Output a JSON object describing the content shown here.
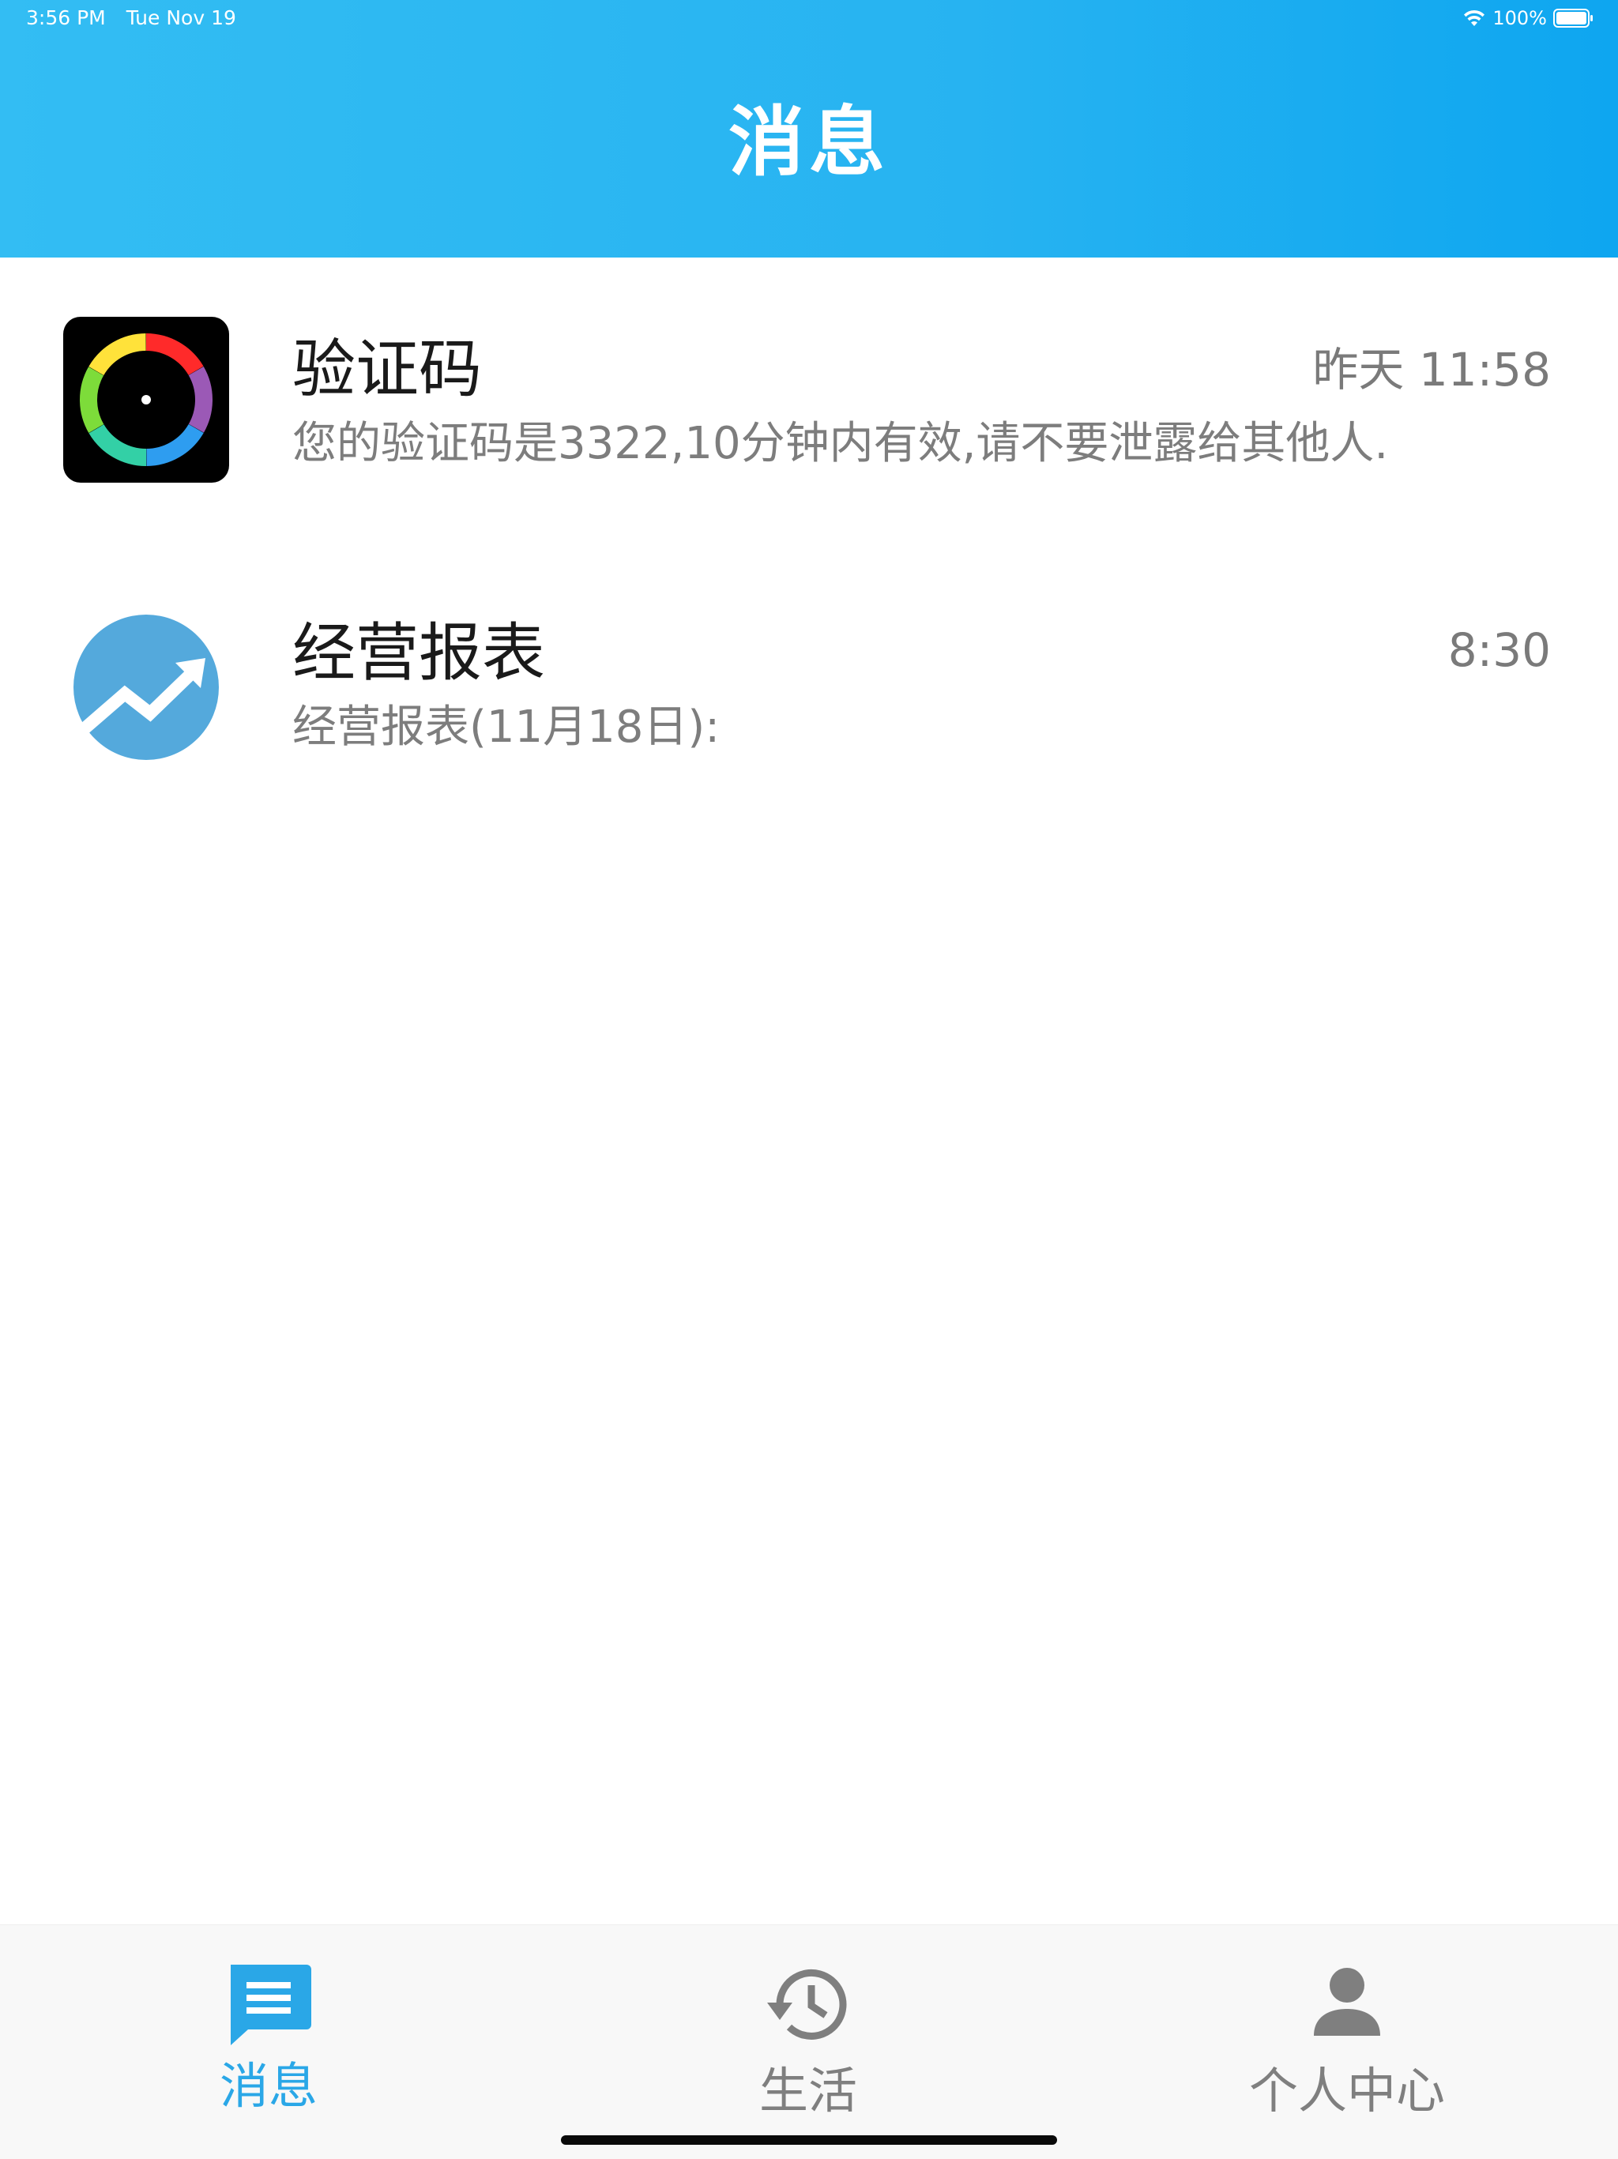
{
  "status_bar": {
    "time": "3:56 PM",
    "date": "Tue Nov 19",
    "battery": "100%"
  },
  "header": {
    "title": "消息"
  },
  "messages": [
    {
      "name": "验证码",
      "time": "昨天 11:58",
      "preview": "您的验证码是3322,10分钟内有效,请不要泄露给其他人.",
      "icon": "color-wheel-icon"
    },
    {
      "name": "经营报表",
      "time": "8:30",
      "preview": "经营报表(11月18日):",
      "icon": "trend-up-icon"
    }
  ],
  "tabbar": {
    "tabs": [
      {
        "label": "消息",
        "icon": "message-icon",
        "active": true
      },
      {
        "label": "生活",
        "icon": "history-icon",
        "active": false
      },
      {
        "label": "个人中心",
        "icon": "person-icon",
        "active": false
      }
    ]
  },
  "colors": {
    "header_start": "#33bdf3",
    "header_end": "#0ea6f0",
    "active_tab": "#2aa7e7",
    "inactive_tab": "#7f7f7f",
    "trend_icon_bg": "#54a9dc"
  }
}
